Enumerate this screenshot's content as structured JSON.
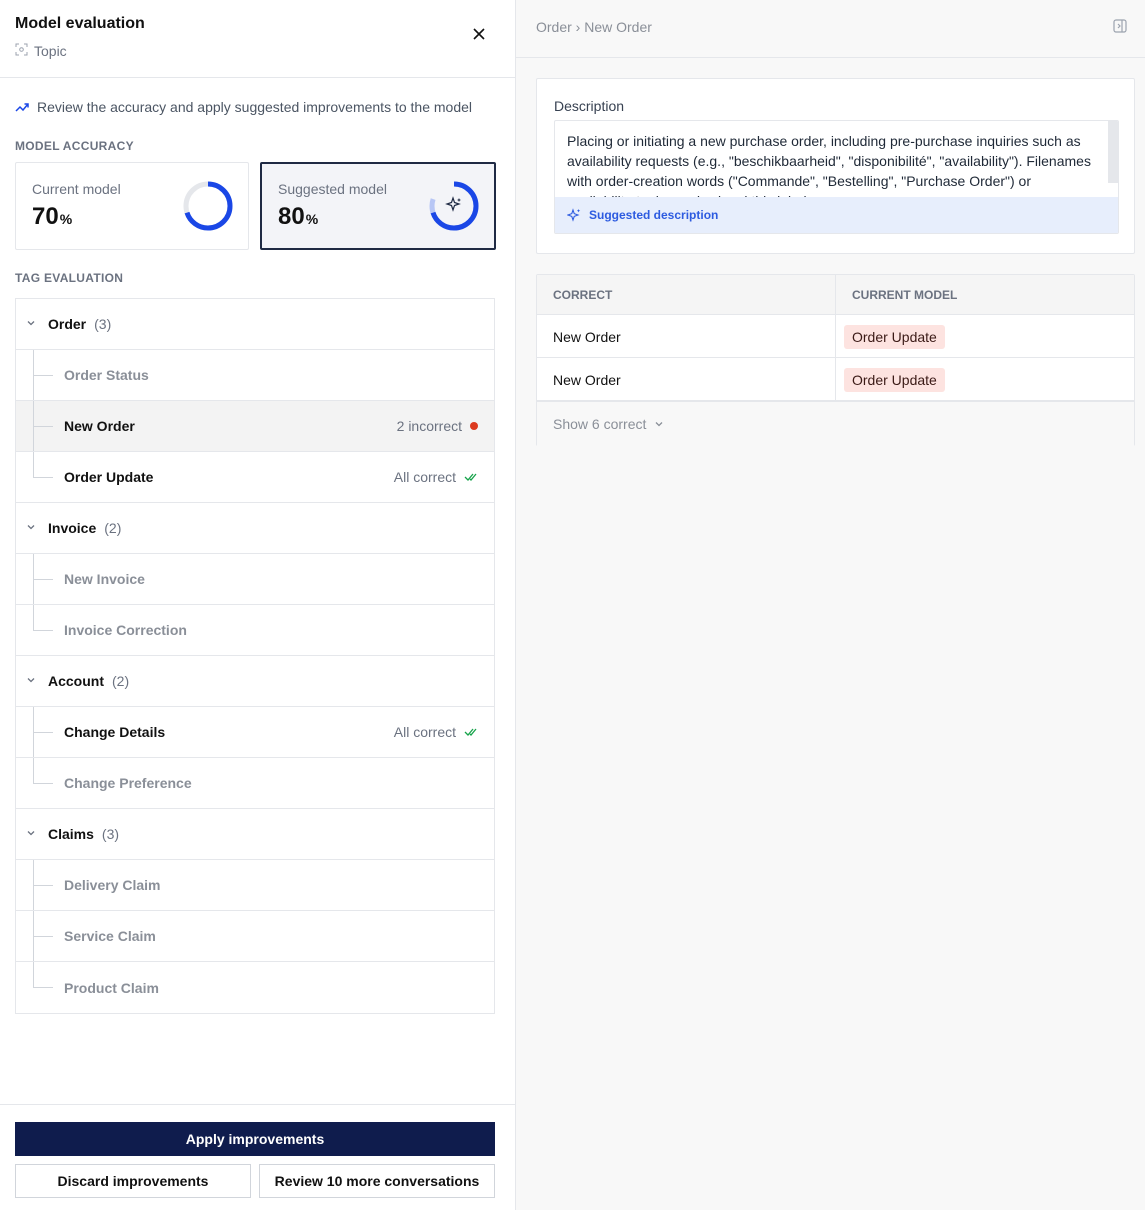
{
  "header": {
    "title": "Model evaluation",
    "subtitle": "Topic"
  },
  "hint": "Review the accuracy and apply suggested improvements to the model",
  "accuracy": {
    "section_label": "MODEL ACCURACY",
    "current": {
      "label": "Current model",
      "value": "70",
      "unit": "%",
      "fraction": 0.7
    },
    "suggested": {
      "label": "Suggested model",
      "value": "80",
      "unit": "%",
      "fraction": 0.8
    }
  },
  "tag_eval": {
    "section_label": "TAG EVALUATION",
    "groups": [
      {
        "name": "Order",
        "count": "(3)"
      },
      {
        "name": "Invoice",
        "count": "(2)"
      },
      {
        "name": "Account",
        "count": "(2)"
      },
      {
        "name": "Claims",
        "count": "(3)"
      }
    ],
    "tags": {
      "order_status": {
        "name": "Order Status"
      },
      "new_order": {
        "name": "New Order",
        "status": "2 incorrect"
      },
      "order_update": {
        "name": "Order Update",
        "status": "All correct"
      },
      "new_invoice": {
        "name": "New Invoice"
      },
      "invoice_correction": {
        "name": "Invoice Correction"
      },
      "change_details": {
        "name": "Change Details",
        "status": "All correct"
      },
      "change_preference": {
        "name": "Change Preference"
      },
      "delivery_claim": {
        "name": "Delivery Claim"
      },
      "service_claim": {
        "name": "Service Claim"
      },
      "product_claim": {
        "name": "Product Claim"
      }
    }
  },
  "footer": {
    "apply_label": "Apply improvements",
    "discard_label": "Discard improvements",
    "review_label": "Review 10 more conversations"
  },
  "detail": {
    "breadcrumb": "Order › New Order",
    "description_label": "Description",
    "description_text": "Placing or initiating a new purchase order, including pre-purchase inquiries such as availability requests (e.g., \"beschikbaarheid\", \"disponibilité\", \"availability\"). Filenames with order-creation words (\"Commande\", \"Bestelling\", \"Purchase Order\") or availability-topic words signal this label.",
    "suggested_label": "Suggested description",
    "table": {
      "col_correct": "CORRECT",
      "col_current": "CURRENT MODEL",
      "rows": [
        {
          "correct": "New Order",
          "current": "Order Update"
        },
        {
          "correct": "New Order",
          "current": "Order Update"
        }
      ],
      "show_more": "Show 6 correct"
    }
  },
  "colors": {
    "accent": "#1a47e6",
    "primary_button": "#0f1c4d",
    "error_dot": "#dc3a1f",
    "success_check": "#16a34a",
    "badge_bg": "#fde3e0"
  }
}
